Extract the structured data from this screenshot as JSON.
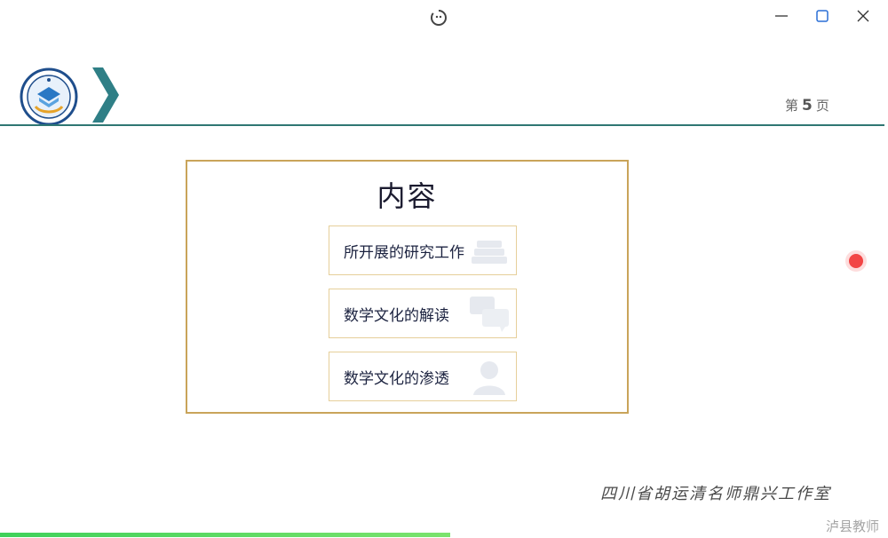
{
  "titlebar": {
    "app_icon": "presentation-app-icon",
    "minimize_icon": "minimize-icon",
    "maximize_icon": "maximize-icon",
    "close_icon": "close-icon"
  },
  "slide": {
    "logo_icon": "school-logo",
    "header_chevron_icon": "chevron-right-icon",
    "header_rule_color": "#2f7773",
    "page": {
      "prefix": "第",
      "number": "5",
      "suffix": "页"
    },
    "content": {
      "title": "内容",
      "items": [
        {
          "label": "所开展的研究工作",
          "deco_icon": "books-icon"
        },
        {
          "label": "数学文化的解读",
          "deco_icon": "chat-bubbles-icon"
        },
        {
          "label": "数学文化的渗透",
          "deco_icon": "person-icon"
        }
      ],
      "border_color": "#c9a45a"
    },
    "studio_name": "四川省胡运清名师鼎兴工作室",
    "laser_pointer_color": "#f24545"
  },
  "progress": {
    "fraction": 0.507,
    "color": "#3fd15a"
  },
  "source_watermark": "泸县教师"
}
